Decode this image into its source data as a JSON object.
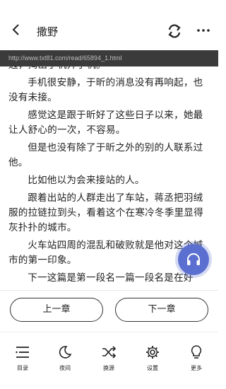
{
  "header": {
    "title": "撒野"
  },
  "url": "http://www.txt81.com/read/65894_1.html",
  "content": {
    "paragraphs": [
      "边，掏出手机开了机。",
      "手机很安静，于昕的消息没有再响起，也没有未接。",
      "感觉这是跟于昕好了这些日子以来，她最让人舒心的一次，不容易。",
      "但是也没有除了于昕之外的别的人联系过他。",
      "比如他以为会来接站的人。",
      "跟着出站的人群走出了车站，蒋丞把羽绒服的拉链拉到头，看着这个在寒冷冬季里显得灰扑扑的城市。",
      "火车站四周的混乱和破败就是他对这个城市的第一印象。",
      "下一这篇是第一段名一篇一段名是在好"
    ]
  },
  "nav": {
    "prev_label": "上一章",
    "next_label": "下一章"
  },
  "toolbar": {
    "items": [
      {
        "label": "目录",
        "icon": "list-icon"
      },
      {
        "label": "夜间",
        "icon": "moon-icon"
      },
      {
        "label": "换源",
        "icon": "shuffle-icon"
      },
      {
        "label": "设置",
        "icon": "gear-icon"
      },
      {
        "label": "更多",
        "icon": "bulb-icon"
      }
    ]
  },
  "colors": {
    "accent": "#5b6fd1",
    "urlbar_bg": "#3b3b3b"
  }
}
